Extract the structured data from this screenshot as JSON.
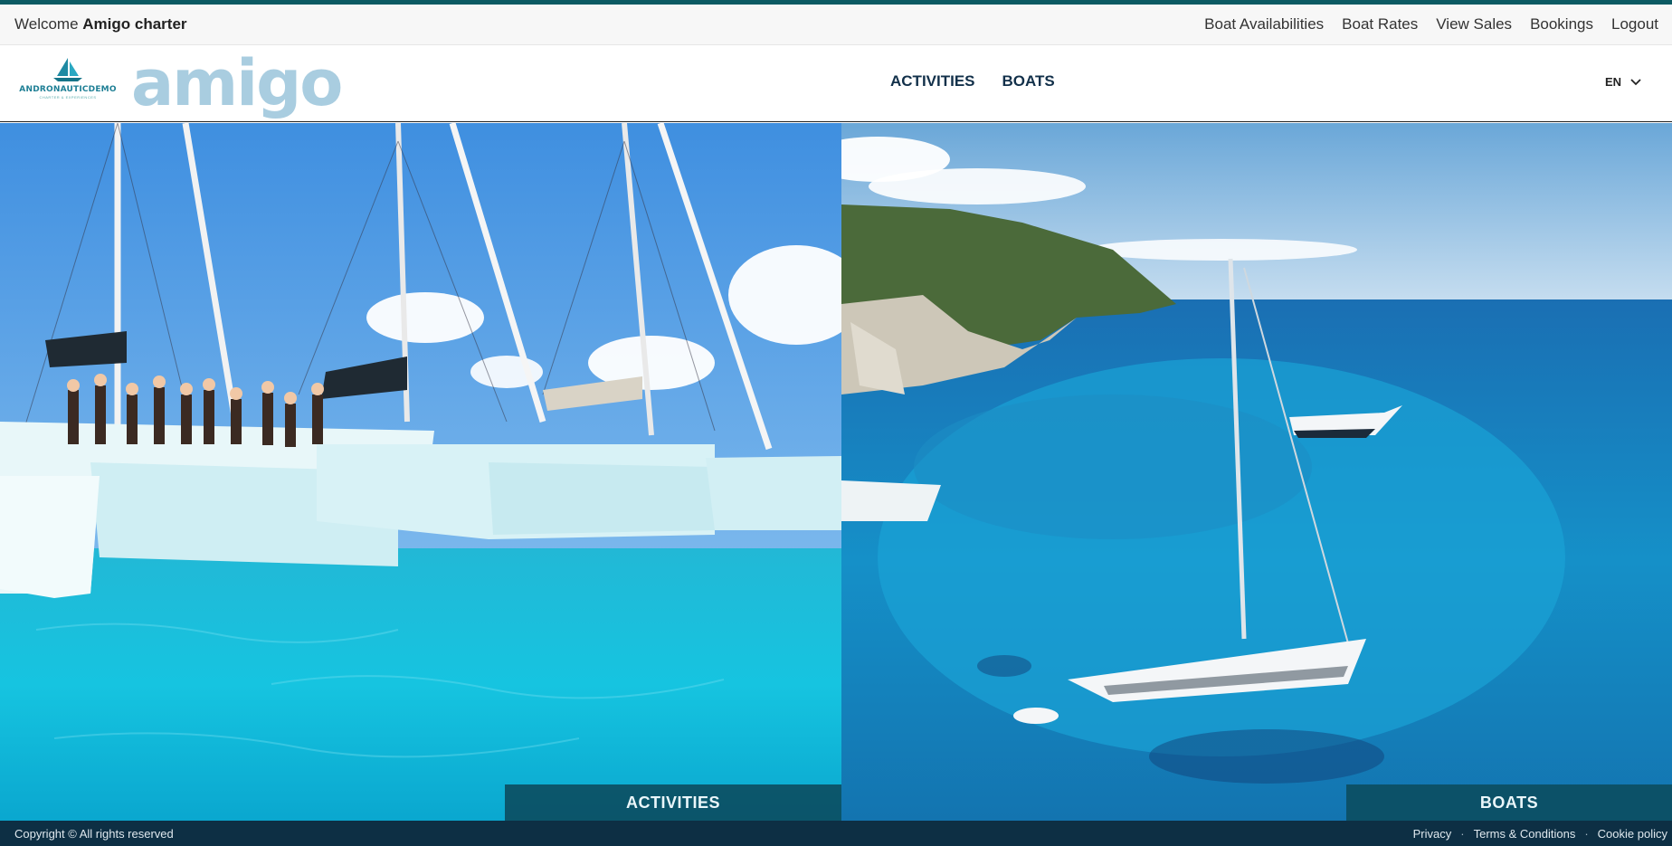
{
  "topbar": {
    "welcome_prefix": "Welcome",
    "user_name": "Amigo charter",
    "links": [
      "Boat Availabilities",
      "Boat Rates",
      "View Sales",
      "Bookings",
      "Logout"
    ]
  },
  "header": {
    "brand_badge": "ANDRONAUTICDEMO",
    "brand_badge_sub": "CHARTER & EXPERIENCES",
    "brand_word": "amigo",
    "nav": [
      "ACTIVITIES",
      "BOATS"
    ],
    "language": "EN"
  },
  "panels": {
    "left_label": "ACTIVITIES",
    "right_label": "BOATS"
  },
  "footer": {
    "copyright": "Copyright © All rights reserved",
    "links": [
      "Privacy",
      "Terms & Conditions",
      "Cookie policy"
    ],
    "separator": "·"
  },
  "colors": {
    "accent": "#0b5a63",
    "nav_text": "#12304a",
    "logo_word": "#a9cde0",
    "panel_label_bg": "#0c4e62",
    "footer_bg": "#0d2f44"
  },
  "icons": {
    "logo": "sailboat-logo-icon",
    "language": "chevron-down-icon"
  }
}
